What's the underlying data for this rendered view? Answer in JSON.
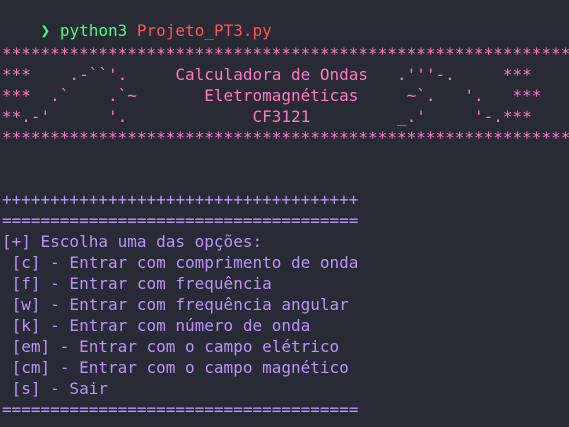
{
  "colors": {
    "background": "#282a36",
    "prompt_arrow": "#50fa7b",
    "command": "#50fa7b",
    "argument": "#ff5555",
    "banner": "#ff79c6",
    "menu": "#bd93f9"
  },
  "prompt": {
    "arrow_icon": "chevron-right-icon",
    "arrow_glyph": "❯",
    "command": "python3",
    "argument": "Projeto_PT3.py"
  },
  "banner": {
    "border_top": "***********************************************************",
    "line1": "***    .-``'.     Calculadora de Ondas   .'''-.     ***",
    "line2": "***  .`    .`~       Eletromagnéticas     ~`.   '.   ***",
    "line3": "**.-'      '.             CF3121         _.'     '-.***",
    "border_bottom": "***********************************************************"
  },
  "menu": {
    "plus_border": "+++++++++++++++++++++++++++++++++++++",
    "eq_border_top": "=====================================",
    "heading": "[+] Escolha uma das opções:",
    "options": [
      " [c] - Entrar com comprimento de onda",
      " [f] - Entrar com frequência",
      " [w] - Entrar com frequência angular",
      " [k] - Entrar com número de onda",
      " [em] - Entrar com o campo elétrico",
      " [cm] - Entrar com o campo magnético",
      " [s] - Sair"
    ],
    "eq_border_bottom": "====================================="
  }
}
